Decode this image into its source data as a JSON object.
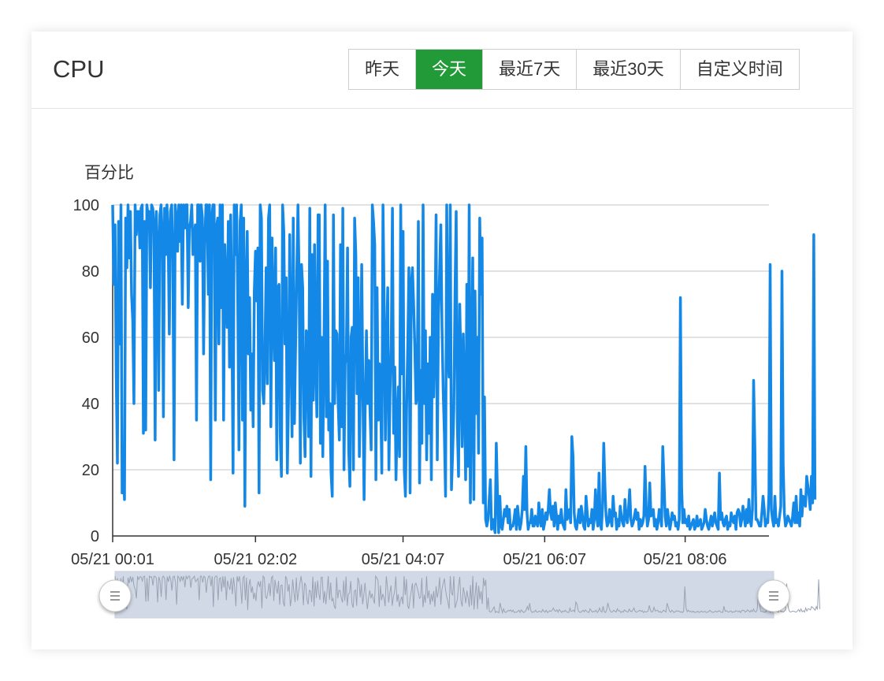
{
  "panel": {
    "title": "CPU",
    "ranges": [
      {
        "label": "昨天",
        "active": false
      },
      {
        "label": "今天",
        "active": true
      },
      {
        "label": "最近7天",
        "active": false
      },
      {
        "label": "最近30天",
        "active": false
      },
      {
        "label": "自定义时间",
        "active": false
      }
    ],
    "accent_color": "#239a38"
  },
  "chart_data": {
    "type": "line",
    "ylabel": "百分比",
    "ylim": [
      0,
      100
    ],
    "yticks": [
      0,
      20,
      40,
      60,
      80,
      100
    ],
    "xticks": [
      {
        "label": "05/21 00:01",
        "minute": 1
      },
      {
        "label": "05/21 02:02",
        "minute": 122
      },
      {
        "label": "05/21 04:07",
        "minute": 247
      },
      {
        "label": "05/21 06:07",
        "minute": 367
      },
      {
        "label": "05/21 08:06",
        "minute": 486
      }
    ],
    "xrange_minutes": [
      1,
      557
    ],
    "grid": true,
    "line_color": "#1388e6",
    "datazoom": {
      "start": 0,
      "end": 1,
      "fill": "#d2d9e6"
    },
    "series": [
      {
        "sample_interval_minutes": 1,
        "values": [
          100,
          76,
          94,
          49,
          22,
          95,
          58,
          100,
          13,
          23,
          11,
          96,
          81,
          100,
          84,
          98,
          73,
          65,
          40,
          100,
          91,
          98,
          98,
          87,
          99,
          100,
          31,
          95,
          32,
          100,
          97,
          98,
          75,
          100,
          99,
          94,
          29,
          98,
          87,
          44,
          97,
          100,
          91,
          36,
          99,
          85,
          100,
          91,
          61,
          98,
          100,
          84,
          23,
          100,
          96,
          86,
          100,
          89,
          100,
          70,
          100,
          93,
          100,
          100,
          69,
          93,
          95,
          100,
          85,
          89,
          94,
          35,
          100,
          100,
          83,
          100,
          96,
          55,
          88,
          100,
          100,
          73,
          100,
          17,
          96,
          100,
          100,
          35,
          93,
          96,
          58,
          100,
          69,
          100,
          35,
          88,
          74,
          63,
          95,
          51,
          97,
          67,
          19,
          100,
          85,
          100,
          71,
          26,
          95,
          100,
          35,
          96,
          9,
          75,
          92,
          55,
          72,
          38,
          55,
          33,
          74,
          86,
          71,
          87,
          13,
          100,
          96,
          44,
          40,
          56,
          81,
          46,
          96,
          100,
          33,
          90,
          68,
          53,
          87,
          23,
          75,
          76,
          30,
          18,
          100,
          92,
          58,
          78,
          19,
          42,
          91,
          57,
          30,
          96,
          34,
          58,
          80,
          100,
          77,
          22,
          82,
          75,
          36,
          24,
          62,
          60,
          30,
          99,
          18,
          85,
          41,
          88,
          54,
          36,
          97,
          97,
          28,
          60,
          24,
          58,
          100,
          36,
          83,
          32,
          40,
          19,
          12,
          97,
          40,
          62,
          61,
          40,
          29,
          88,
          33,
          99,
          20,
          52,
          55,
          87,
          26,
          15,
          60,
          63,
          20,
          96,
          85,
          43,
          78,
          24,
          50,
          82,
          43,
          11,
          41,
          62,
          40,
          53,
          38,
          26,
          100,
          95,
          88,
          17,
          75,
          35,
          52,
          42,
          19,
          100,
          70,
          29,
          56,
          75,
          20,
          44,
          58,
          99,
          31,
          51,
          17,
          35,
          45,
          24,
          100,
          49,
          92,
          20,
          12,
          39,
          58,
          81,
          13,
          76,
          81,
          70,
          57,
          40,
          43,
          95,
          16,
          50,
          28,
          100,
          40,
          62,
          23,
          52,
          31,
          60,
          17,
          73,
          42,
          60,
          97,
          23,
          66,
          80,
          94,
          63,
          44,
          31,
          12,
          100,
          55,
          48,
          100,
          14,
          25,
          38,
          73,
          98,
          33,
          18,
          70,
          52,
          27,
          61,
          42,
          17,
          76,
          21,
          100,
          10,
          50,
          84,
          11,
          74,
          37,
          60,
          25,
          96,
          73,
          90,
          10,
          42,
          5,
          3,
          5,
          11,
          17,
          2,
          5,
          3,
          1,
          28,
          13,
          1,
          12,
          3,
          2,
          5,
          8,
          6,
          9,
          4,
          8,
          2,
          3,
          3,
          5,
          8,
          2,
          9,
          5,
          2,
          4,
          8,
          18,
          8,
          27,
          7,
          2,
          4,
          4,
          8,
          3,
          3,
          6,
          4,
          3,
          10,
          5,
          3,
          8,
          2,
          4,
          7,
          5,
          8,
          14,
          7,
          5,
          9,
          3,
          10,
          6,
          2,
          6,
          4,
          8,
          4,
          3,
          2,
          14,
          5,
          6,
          8,
          4,
          30,
          24,
          7,
          3,
          2,
          5,
          8,
          4,
          9,
          6,
          3,
          2,
          12,
          7,
          3,
          5,
          4,
          8,
          2,
          5,
          14,
          6,
          3,
          19,
          4,
          2,
          9,
          28,
          15,
          6,
          3,
          4,
          8,
          5,
          3,
          12,
          6,
          7,
          2,
          5,
          3,
          9,
          6,
          4,
          3,
          11,
          6,
          4,
          8,
          14,
          5,
          3,
          4,
          6,
          8,
          5,
          7,
          2,
          5,
          3,
          4,
          6,
          21,
          8,
          3,
          5,
          16,
          6,
          7,
          8,
          3,
          5,
          2,
          4,
          8,
          6,
          3,
          27,
          17,
          6,
          3,
          8,
          5,
          2,
          4,
          7,
          5,
          6,
          3,
          4,
          2,
          5,
          72,
          15,
          4,
          8,
          4,
          5,
          3,
          6,
          2,
          3,
          4,
          5,
          2,
          3,
          6,
          3,
          4,
          5,
          2,
          3,
          4,
          8,
          5,
          3,
          2,
          4,
          6,
          3,
          5,
          7,
          4,
          3,
          2,
          19,
          5,
          7,
          4,
          3,
          5,
          6,
          2,
          4,
          3,
          7,
          5,
          4,
          6,
          2,
          7,
          8,
          7,
          3,
          5,
          9,
          6,
          3,
          8,
          4,
          11,
          5,
          3,
          8,
          47,
          28,
          5,
          5,
          4,
          3,
          3,
          7,
          12,
          8,
          3,
          5,
          4,
          13,
          82,
          8,
          5,
          3,
          12,
          4,
          5,
          3,
          6,
          9,
          80,
          22,
          7,
          3,
          4,
          6,
          5,
          4,
          3,
          6,
          10,
          4,
          12,
          4,
          7,
          3,
          14,
          6,
          12,
          11,
          9,
          18,
          15,
          12,
          8,
          18,
          10,
          91,
          11
        ]
      }
    ]
  }
}
